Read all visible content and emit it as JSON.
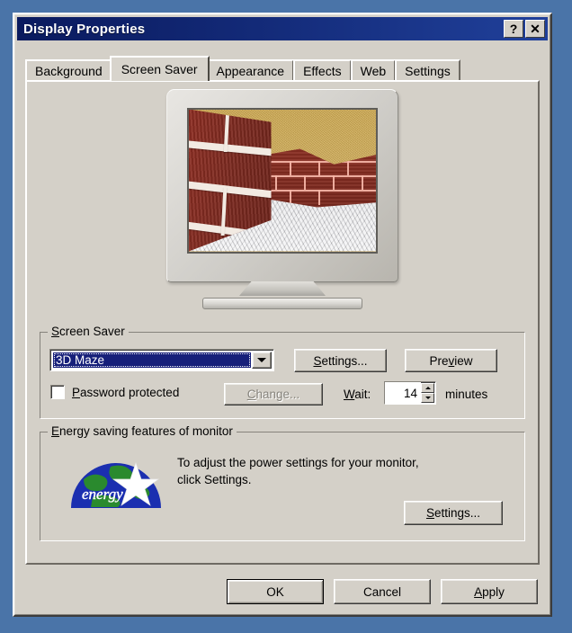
{
  "window": {
    "title": "Display Properties",
    "help_button": "?",
    "close_button": "✕"
  },
  "tabs": [
    {
      "label": "Background",
      "active": false
    },
    {
      "label": "Screen Saver",
      "active": true
    },
    {
      "label": "Appearance",
      "active": false
    },
    {
      "label": "Effects",
      "active": false
    },
    {
      "label": "Web",
      "active": false
    },
    {
      "label": "Settings",
      "active": false
    }
  ],
  "preview": {
    "screensaver_name": "3D Maze",
    "scene_description": "3D Maze screensaver preview: red brick walls, tan ceiling, gray stone floor"
  },
  "screen_saver_group": {
    "label": "Screen Saver",
    "label_accel": "S",
    "combo_value": "3D Maze",
    "settings_button": "Settings...",
    "settings_accel": "S",
    "preview_button": "Preview",
    "preview_accel": "v",
    "password_checkbox_label": "Password protected",
    "password_accel": "P",
    "password_checked": false,
    "change_button": "Change...",
    "change_accel": "C",
    "change_enabled": false,
    "wait_label": "Wait:",
    "wait_accel": "W",
    "wait_value": "14",
    "wait_units": "minutes"
  },
  "energy_group": {
    "label": "Energy saving features of monitor",
    "label_accel": "E",
    "description_line1": "To adjust the power settings for your monitor,",
    "description_line2": "click Settings.",
    "settings_button": "Settings...",
    "settings_accel": "S",
    "logo_name": "energy-star-logo",
    "logo_text": "energy"
  },
  "footer": {
    "ok_button": "OK",
    "cancel_button": "Cancel",
    "apply_button": "Apply",
    "apply_accel": "A"
  },
  "colors": {
    "desktop_background": "#4a74a8",
    "dialog_face": "#d4d0c8",
    "titlebar_start": "#0a1a5e",
    "titlebar_end": "#20409a",
    "selection_blue": "#17207a",
    "brick_red": "#7d2a20",
    "ceiling_tan": "#cfa94f",
    "floor_gray": "#d9d9dc",
    "disabled_text": "#86837c"
  }
}
